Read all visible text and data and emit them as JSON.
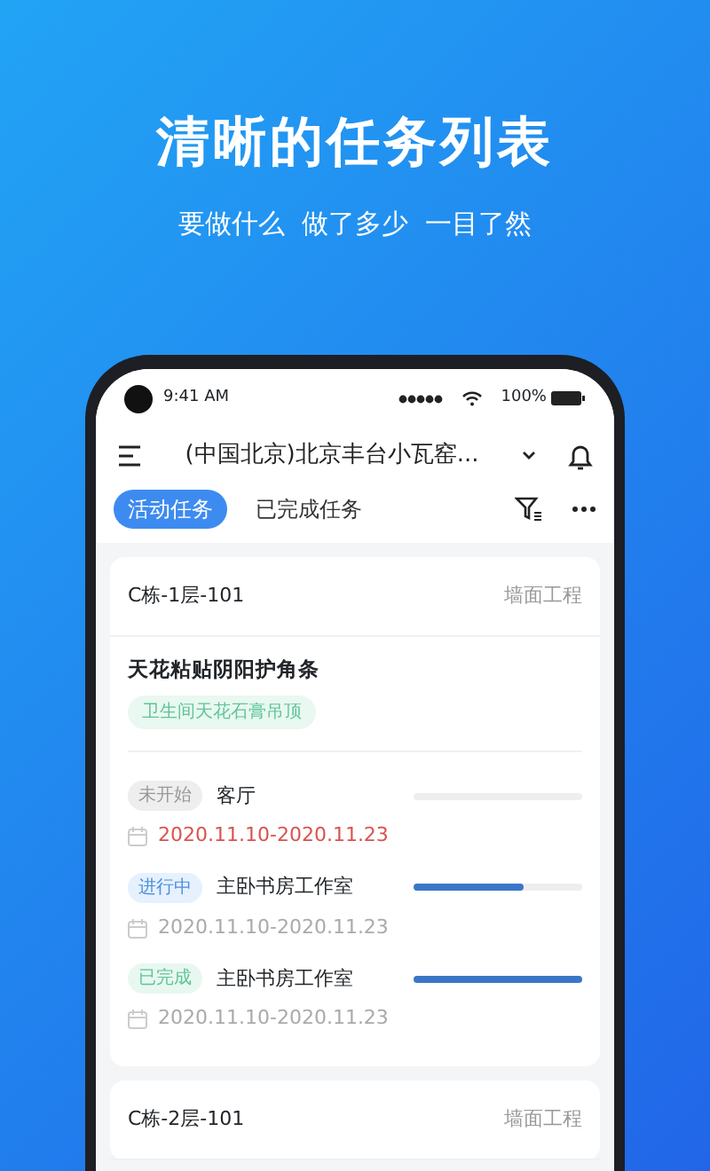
{
  "promo": {
    "headline": "清晰的任务列表",
    "subtitle": "要做什么  做了多少  一目了然"
  },
  "status_bar": {
    "time": "9:41 AM",
    "battery": "100%"
  },
  "header": {
    "title": "(中国北京)北京丰台小瓦窑..."
  },
  "tabs": [
    {
      "label": "活动任务",
      "selected": true
    },
    {
      "label": "已完成任务",
      "selected": false
    }
  ],
  "cards": [
    {
      "location": "C栋-1层-101",
      "category": "墙面工程",
      "task": "天花粘贴阴阳护角条",
      "tag": "卫生间天花石膏吊顶",
      "steps": [
        {
          "kind": "not_started",
          "status": "未开始",
          "room": "客厅",
          "level": 0,
          "dates": "2020.11.10-2020.11.23",
          "overdue": true
        },
        {
          "kind": "in_progress",
          "status": "进行中",
          "room": "主卧书房工作室",
          "level": 0.65,
          "dates": "2020.11.10-2020.11.23",
          "overdue": false
        },
        {
          "kind": "done",
          "status": "已完成",
          "room": "主卧书房工作室",
          "level": 1,
          "dates": "2020.11.10-2020.11.23",
          "overdue": false
        }
      ]
    },
    {
      "location": "C栋-2层-101",
      "category": "墙面工程"
    }
  ]
}
